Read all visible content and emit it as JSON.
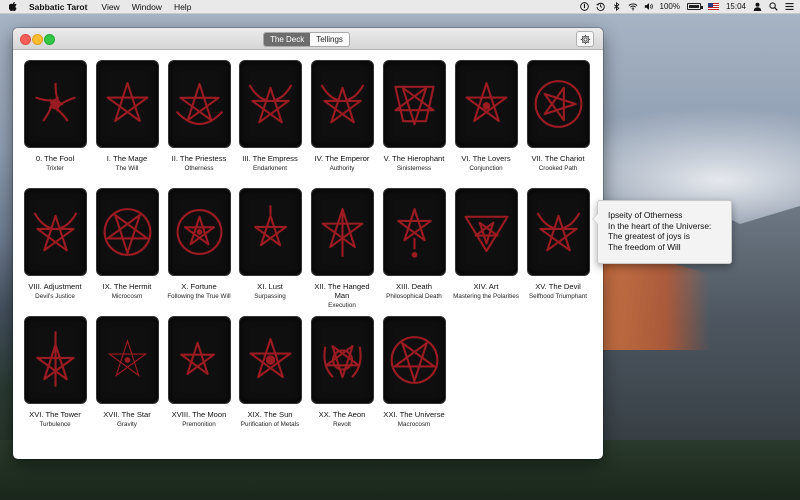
{
  "menubar": {
    "app_name": "Sabbatic Tarot",
    "menus": [
      "View",
      "Window",
      "Help"
    ],
    "battery_label": "100%",
    "battery_level": 1.0,
    "clock": "15:04"
  },
  "window": {
    "tabs": [
      {
        "label": "The Deck",
        "active": true
      },
      {
        "label": "Tellings",
        "active": false
      }
    ],
    "settings_icon": "gear-icon"
  },
  "colors": {
    "card_background": "#0f0f10",
    "sigil": "#9b1b22",
    "active_tab": "#6d6d6d"
  },
  "cards": [
    {
      "title": "0. The Fool",
      "subtitle": "Trixter",
      "sigil": "vortex-star"
    },
    {
      "title": "I. The Mage",
      "subtitle": "The Will",
      "sigil": "pentagram"
    },
    {
      "title": "II. The Priestess",
      "subtitle": "Otherness",
      "sigil": "pentagram-arcs"
    },
    {
      "title": "III. The Empress",
      "subtitle": "Endarkment",
      "sigil": "horned-pentagram"
    },
    {
      "title": "IV. The Emperor",
      "subtitle": "Authority",
      "sigil": "horned-pentagram"
    },
    {
      "title": "V. The Hierophant",
      "subtitle": "Sinisterness",
      "sigil": "crowned-pentagram"
    },
    {
      "title": "VI. The Lovers",
      "subtitle": "Conjunction",
      "sigil": "pentagram-dot"
    },
    {
      "title": "VII. The Chariot",
      "subtitle": "Crooked Path",
      "sigil": "circled-vortex"
    },
    {
      "title": "VIII. Adjustment",
      "subtitle": "Devil's Justice",
      "sigil": "horned-pentagram"
    },
    {
      "title": "IX. The Hermit",
      "subtitle": "Microcosm",
      "sigil": "circled-pentagram"
    },
    {
      "title": "X. Fortune",
      "subtitle": "Following the True Will",
      "sigil": "wheel-pentagram"
    },
    {
      "title": "XI. Lust",
      "subtitle": "Surpassing",
      "sigil": "small-star"
    },
    {
      "title": "XII. The Hanged Man",
      "subtitle": "Execution",
      "sigil": "long-star"
    },
    {
      "title": "XIII. Death",
      "subtitle": "Philosophical Death",
      "sigil": "star-drop"
    },
    {
      "title": "XIV. Art",
      "subtitle": "Mastering the Polarities",
      "sigil": "triangle-star"
    },
    {
      "title": "XV. The Devil",
      "subtitle": "Selfhood Triumphant",
      "sigil": "horned-pentagram"
    },
    {
      "title": "XVI. The Tower",
      "subtitle": "Turbulence",
      "sigil": "tower-star"
    },
    {
      "title": "XVII. The Star",
      "subtitle": "Gravity",
      "sigil": "thin-star"
    },
    {
      "title": "XVIII. The Moon",
      "subtitle": "Premonition",
      "sigil": "moon-pentagram"
    },
    {
      "title": "XIX. The Sun",
      "subtitle": "Purification of Metals",
      "sigil": "sun-star"
    },
    {
      "title": "XX. The Aeon",
      "subtitle": "Revolt",
      "sigil": "spiral-star"
    },
    {
      "title": "XXI. The Universe",
      "subtitle": "Macrocosm",
      "sigil": "circled-pentagram"
    }
  ],
  "tooltip": {
    "lines": [
      "Ipseity of Otherness",
      "In the heart of the Universe:",
      "The greatest of joys is",
      "The freedom of Will"
    ]
  }
}
